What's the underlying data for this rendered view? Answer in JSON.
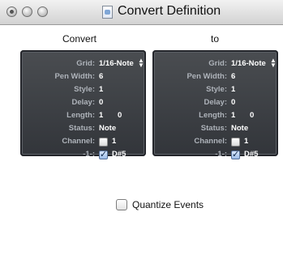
{
  "window": {
    "title": "Convert Definition"
  },
  "columns": {
    "left_label": "Convert",
    "right_label": "to"
  },
  "panels": [
    {
      "grid": "1/16-Note",
      "pen_width": "6",
      "style": "1",
      "delay": "0",
      "length_a": "1",
      "length_b": "0",
      "status": "Note",
      "channel": "1",
      "note": "D#5"
    },
    {
      "grid": "1/16-Note",
      "pen_width": "6",
      "style": "1",
      "delay": "0",
      "length_a": "1",
      "length_b": "0",
      "status": "Note",
      "channel": "1",
      "note": "D#5"
    }
  ],
  "labels": {
    "grid": "Grid:",
    "pen_width": "Pen Width:",
    "style": "Style:",
    "delay": "Delay:",
    "length": "Length:",
    "status": "Status:",
    "channel": "Channel:",
    "note_row": "-1-:"
  },
  "options": {
    "quantize_label": "Quantize Events"
  }
}
